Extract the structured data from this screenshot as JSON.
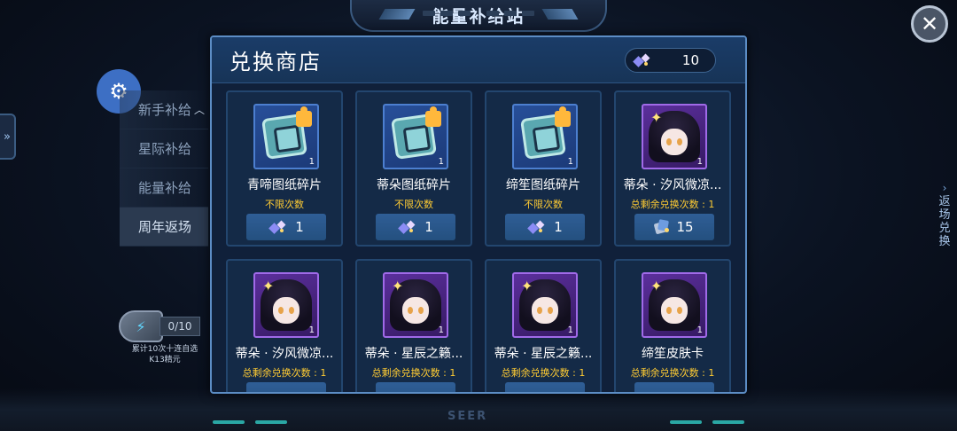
{
  "header": {
    "title": "能量补给站",
    "close_label": "✕"
  },
  "sidebar": {
    "items": [
      {
        "label": "新手补给",
        "expanded": true
      },
      {
        "label": "星际补给"
      },
      {
        "label": "能量补给"
      },
      {
        "label": "周年返场",
        "active": true
      }
    ]
  },
  "progress": {
    "count": "0/10",
    "caption_line1": "累计10次十连自选",
    "caption_line2": "K13精元"
  },
  "right_tab": {
    "label": "返场兑换"
  },
  "footer": {
    "logo": "SEER"
  },
  "shop": {
    "title": "兑换商店",
    "currency": {
      "icon": "gem-currency-icon",
      "value": "10"
    },
    "items": [
      {
        "name": "青啼图纸碎片",
        "qty": "1",
        "limit": "不限次数",
        "price": "1",
        "price_icon": "gem-currency-icon",
        "icon": "blueprint-fragment-icon"
      },
      {
        "name": "蒂朵图纸碎片",
        "qty": "1",
        "limit": "不限次数",
        "price": "1",
        "price_icon": "gem-currency-icon",
        "icon": "blueprint-fragment-icon"
      },
      {
        "name": "缔笙图纸碎片",
        "qty": "1",
        "limit": "不限次数",
        "price": "1",
        "price_icon": "gem-currency-icon",
        "icon": "blueprint-fragment-icon"
      },
      {
        "name": "蒂朵 · 汐风微凉...",
        "qty": "1",
        "limit": "总剩余兑换次数 : 1",
        "price": "15",
        "price_icon": "book-currency-icon",
        "icon": "character-portrait-icon"
      },
      {
        "name": "蒂朵 · 汐风微凉...",
        "qty": "1",
        "limit": "总剩余兑换次数 : 1",
        "icon": "character-portrait-icon"
      },
      {
        "name": "蒂朵 · 星辰之籁...",
        "qty": "1",
        "limit": "总剩余兑换次数 : 1",
        "icon": "character-portrait-icon"
      },
      {
        "name": "蒂朵 · 星辰之籁...",
        "qty": "1",
        "limit": "总剩余兑换次数 : 1",
        "icon": "character-portrait-icon"
      },
      {
        "name": "缔笙皮肤卡",
        "qty": "1",
        "limit": "总剩余兑换次数 : 1",
        "icon": "character-portrait-icon"
      }
    ]
  }
}
